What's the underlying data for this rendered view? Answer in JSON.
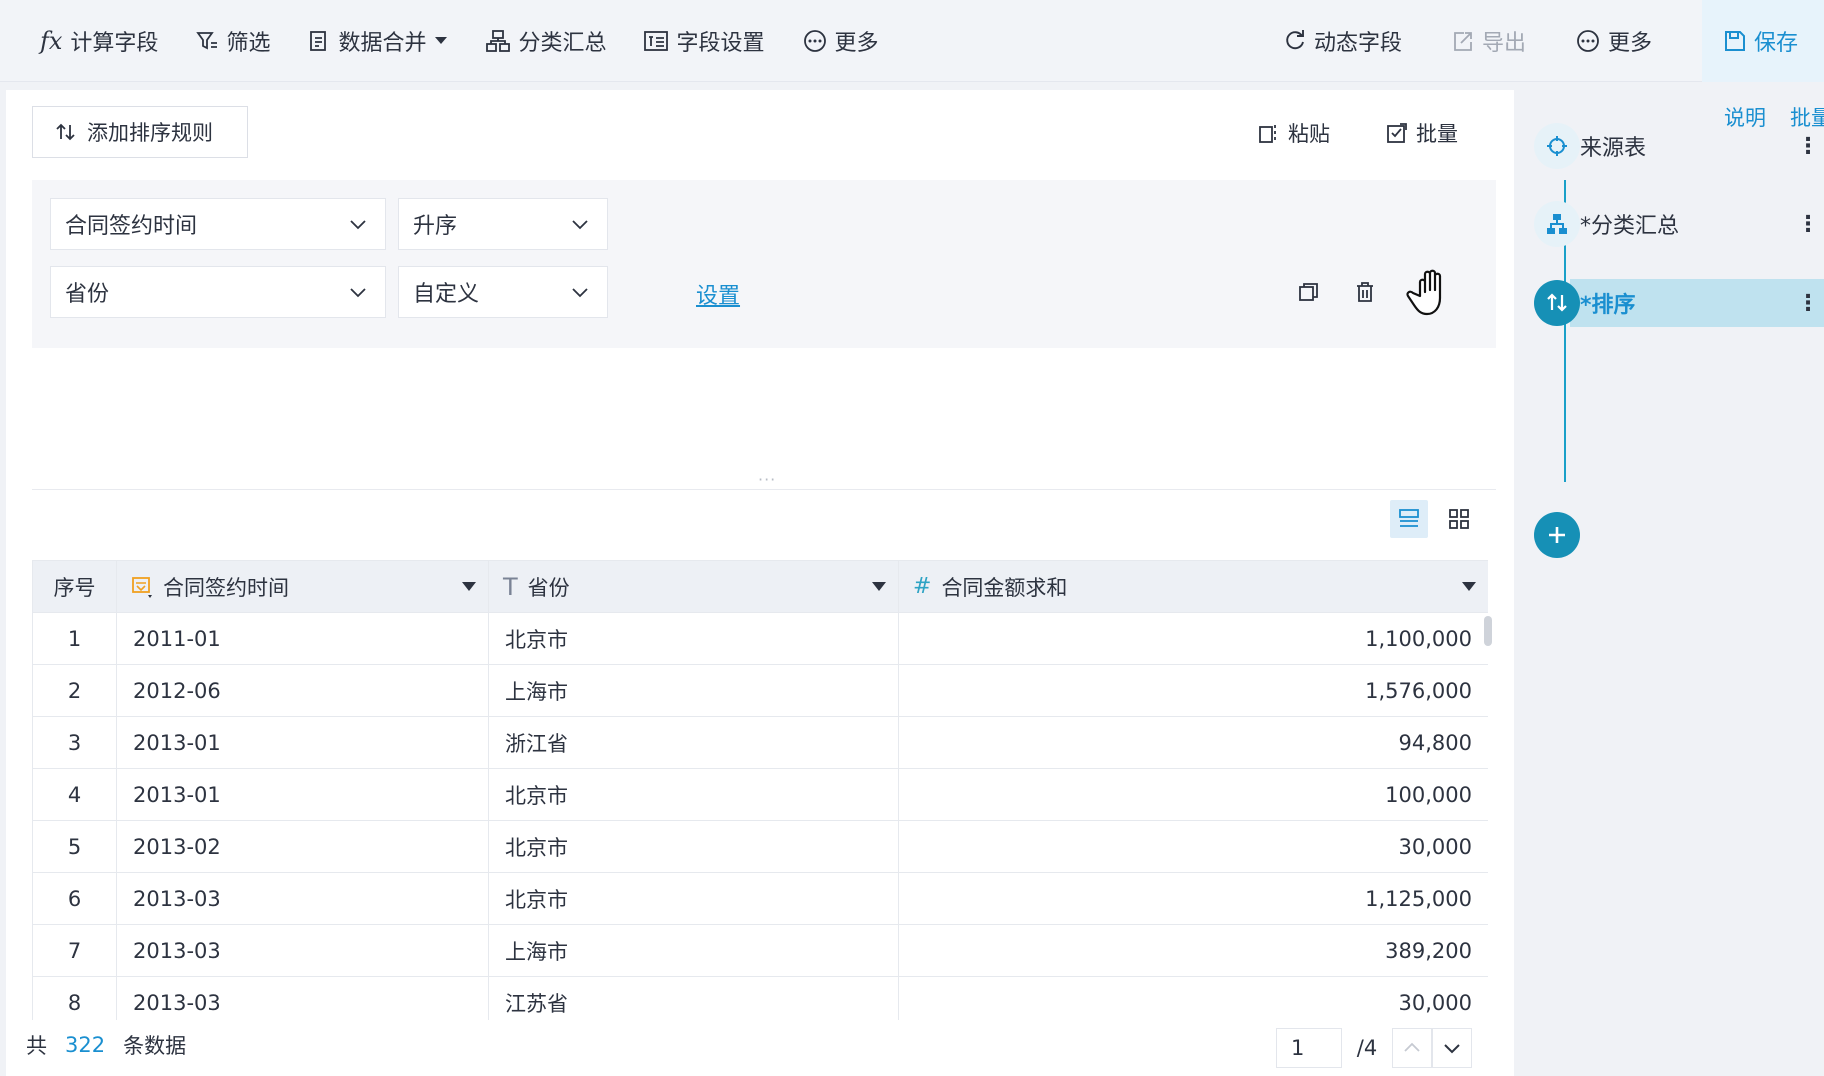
{
  "toolbar": {
    "left": [
      {
        "label": "计算字段",
        "icon": "fx-icon"
      },
      {
        "label": "筛选",
        "icon": "filter-icon"
      },
      {
        "label": "数据合并",
        "icon": "merge-icon"
      },
      {
        "label": "分类汇总",
        "icon": "group-icon"
      },
      {
        "label": "字段设置",
        "icon": "field-settings-icon"
      },
      {
        "label": "更多",
        "icon": "more-circle-icon"
      }
    ],
    "fx_text": "fx",
    "right": {
      "dynamic_field": "动态字段",
      "export": "导出",
      "more": "更多",
      "save": "保存"
    }
  },
  "sort_panel": {
    "add_rule": "添加排序规则",
    "paste": "粘贴",
    "batch": "批量",
    "rules": [
      {
        "field": "合同签约时间",
        "order": "升序"
      },
      {
        "field": "省份",
        "order": "自定义",
        "link": "设置"
      }
    ],
    "drag_handle": "···"
  },
  "table": {
    "columns": [
      {
        "label": "序号",
        "type": "index"
      },
      {
        "label": "合同签约时间",
        "type": "date"
      },
      {
        "label": "省份",
        "type": "text"
      },
      {
        "label": "合同金额求和",
        "type": "number"
      }
    ],
    "type_glyphs": {
      "text": "T",
      "number": "#"
    },
    "rows": [
      [
        "1",
        "2011-01",
        "北京市",
        "1,100,000"
      ],
      [
        "2",
        "2012-06",
        "上海市",
        "1,576,000"
      ],
      [
        "3",
        "2013-01",
        "浙江省",
        "94,800"
      ],
      [
        "4",
        "2013-01",
        "北京市",
        "100,000"
      ],
      [
        "5",
        "2013-02",
        "北京市",
        "30,000"
      ],
      [
        "6",
        "2013-03",
        "北京市",
        "1,125,000"
      ],
      [
        "7",
        "2013-03",
        "上海市",
        "389,200"
      ],
      [
        "8",
        "2013-03",
        "江苏省",
        "30,000"
      ]
    ]
  },
  "footer": {
    "prefix": "共",
    "count": "322",
    "suffix": "条数据",
    "page": "1",
    "total_pages": "/4"
  },
  "steps": {
    "links": {
      "explain": "说明",
      "batch": "批量"
    },
    "items": [
      {
        "label": "来源表",
        "icon": "source-icon"
      },
      {
        "label": "*分类汇总",
        "icon": "group-icon"
      },
      {
        "label": "*排序",
        "icon": "sort-icon",
        "active": true
      }
    ],
    "more_glyph": "⋮"
  },
  "colors": {
    "accent": "#1a8fd0",
    "step_active": "#1690b6",
    "date_icon": "#f0a020"
  }
}
